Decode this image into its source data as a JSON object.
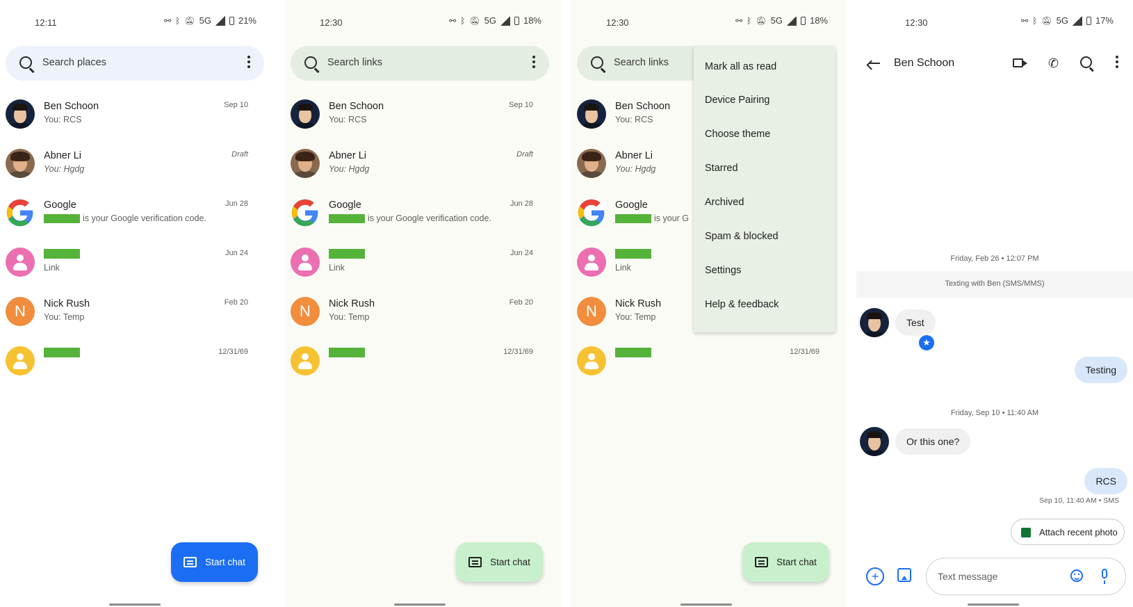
{
  "colors": {
    "accent_blue": "#1b6ef3",
    "fab_green": "#c8f0cc",
    "redaction_green": "#55b33a",
    "outgoing_bubble": "#d9e7fb",
    "incoming_bubble": "#f0f0f0"
  },
  "panels": [
    {
      "status": {
        "time": "12:11",
        "network": "5G",
        "battery": "21%"
      },
      "search_placeholder": "Search places",
      "fab_label": "Start chat"
    },
    {
      "status": {
        "time": "12:30",
        "network": "5G",
        "battery": "18%"
      },
      "search_placeholder": "Search links",
      "fab_label": "Start chat"
    },
    {
      "status": {
        "time": "12:30",
        "network": "5G",
        "battery": "18%"
      },
      "search_placeholder": "Search links",
      "fab_label": "Start chat"
    }
  ],
  "conversations": [
    {
      "name": "Ben Schoon",
      "snippet": "You: RCS",
      "date": "Sep 10",
      "avatar_icon": "person-photo-icon"
    },
    {
      "name": "Abner Li",
      "snippet": "You: Hgdg",
      "date": "Draft",
      "avatar_icon": "person-photo-icon"
    },
    {
      "name": "Google",
      "snippet": "is your Google verification code.",
      "snippet_short": "is your G",
      "date": "Jun 28",
      "avatar_icon": "google-logo-icon"
    },
    {
      "name": "",
      "snippet": "Link",
      "date": "Jun 24",
      "avatar_icon": "person-icon"
    },
    {
      "name": "Nick Rush",
      "snippet": "You: Temp",
      "date": "Feb 20",
      "avatar_letter": "N"
    },
    {
      "name": "",
      "snippet": "",
      "date": "12/31/69",
      "avatar_icon": "person-icon"
    }
  ],
  "menu": {
    "items": [
      "Mark all as read",
      "Device Pairing",
      "Choose theme",
      "Starred",
      "Archived",
      "Spam & blocked",
      "Settings",
      "Help & feedback"
    ]
  },
  "chat": {
    "status": {
      "time": "12:30",
      "network": "5G",
      "battery": "17%"
    },
    "title": "Ben Schoon",
    "timestamp1": "Friday, Feb 26 • 12:07 PM",
    "banner": "Texting with Ben (SMS/MMS)",
    "messages": [
      {
        "dir": "in",
        "text": "Test"
      },
      {
        "dir": "out",
        "text": "Testing"
      },
      {
        "dir": "in",
        "text": "Or this one?"
      },
      {
        "dir": "out",
        "text": "RCS"
      }
    ],
    "timestamp2": "Friday, Sep 10 • 11:40 AM",
    "message_meta": "Sep 10, 11:40 AM • SMS",
    "attach_label": "Attach recent photo",
    "input_placeholder": "Text message"
  }
}
